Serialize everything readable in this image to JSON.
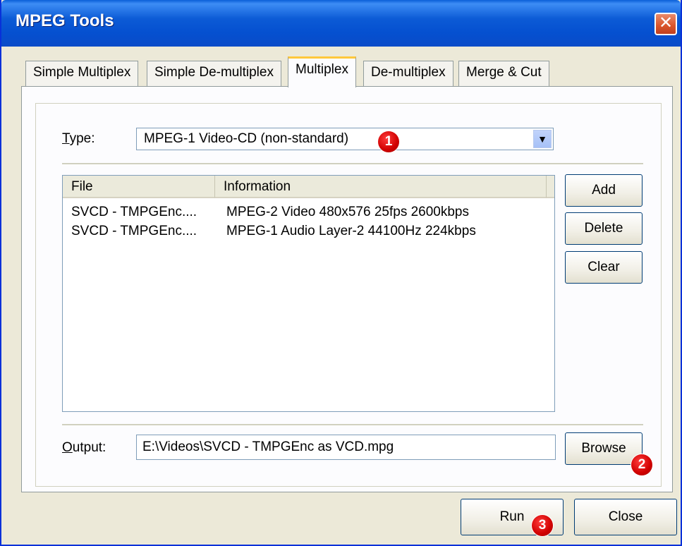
{
  "window": {
    "title": "MPEG Tools",
    "close_glyph": "✕"
  },
  "tabs": [
    {
      "label": "Simple Multiplex"
    },
    {
      "label": "Simple De-multiplex"
    },
    {
      "label": "Multiplex",
      "active": true
    },
    {
      "label": "De-multiplex"
    },
    {
      "label": "Merge & Cut"
    }
  ],
  "type_field": {
    "label_mnemonic": "T",
    "label_rest": "ype:",
    "value": "MPEG-1 Video-CD (non-standard)",
    "arrow_glyph": "▼"
  },
  "file_list": {
    "columns": [
      "File",
      "Information"
    ],
    "rows": [
      {
        "file": "SVCD - TMPGEnc....",
        "information": "MPEG-2 Video 480x576 25fps 2600kbps"
      },
      {
        "file": "SVCD - TMPGEnc....",
        "information": "MPEG-1 Audio Layer-2 44100Hz 224kbps"
      }
    ]
  },
  "list_buttons": {
    "add": "Add",
    "delete": "Delete",
    "clear": "Clear"
  },
  "output_field": {
    "label_mnemonic": "O",
    "label_rest": "utput:",
    "value": "E:\\Videos\\SVCD - TMPGEnc as VCD.mpg",
    "browse": "Browse"
  },
  "footer": {
    "run": "Run",
    "close": "Close"
  },
  "annotations": [
    "1",
    "2",
    "3"
  ],
  "colors": {
    "titlebar": "#0550d0",
    "dialog_bg": "#ece9d8",
    "badge": "#d00000",
    "active_tab_accent": "#ffc83c"
  }
}
